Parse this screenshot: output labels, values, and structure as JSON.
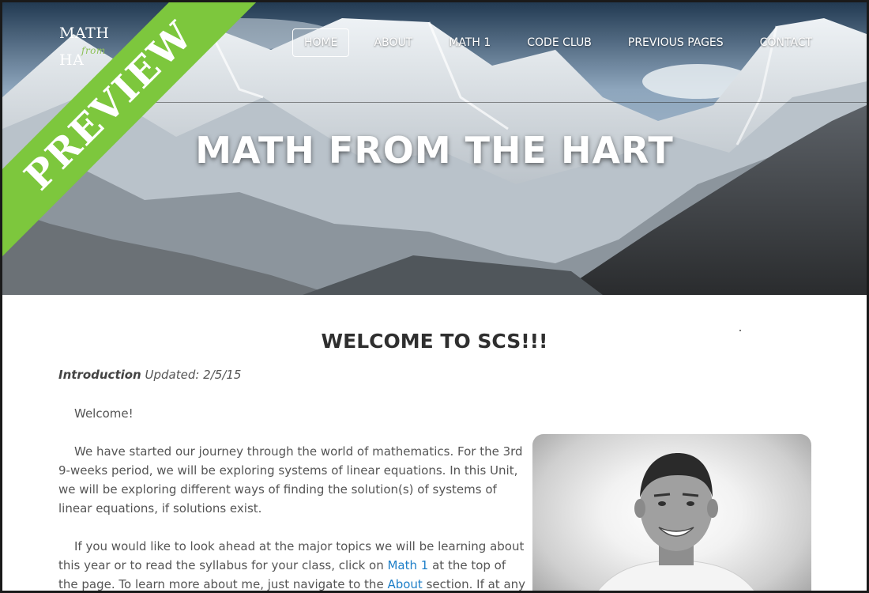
{
  "ribbon": {
    "label": "PREVIEW",
    "color": "#7dc73d"
  },
  "logo": {
    "line1": "MATH",
    "line2": "HA",
    "sub": "from"
  },
  "nav": {
    "items": [
      {
        "label": "HOME",
        "active": true
      },
      {
        "label": "ABOUT"
      },
      {
        "label": "MATH 1"
      },
      {
        "label": "CODE CLUB"
      },
      {
        "label": "PREVIOUS PAGES"
      },
      {
        "label": "CONTACT"
      }
    ]
  },
  "hero": {
    "title": "MATH FROM THE HART"
  },
  "content": {
    "heading": "WELCOME TO SCS!!!",
    "intro_bold": "Introduction",
    "intro_rest": " Updated: 2/5/15",
    "p1": "Welcome!",
    "p2": "We have started our journey through the world of mathematics.  For the 3rd 9-weeks period, we will be exploring systems of linear equations.  In this Unit, we will be exploring different ways of finding the solution(s) of systems of linear equations, if solutions exist.",
    "p3_a": "If you would like to look ahead at the major topics we will be learning about this year or to read the syllabus for your class, click on ",
    "p3_link1": "Math 1",
    "p3_b": " at the top of the page.  To learn more about me, just navigate to the ",
    "p3_link2": "About",
    "p3_c": " section. If at any time",
    "link_color": "#1e7fc8"
  }
}
